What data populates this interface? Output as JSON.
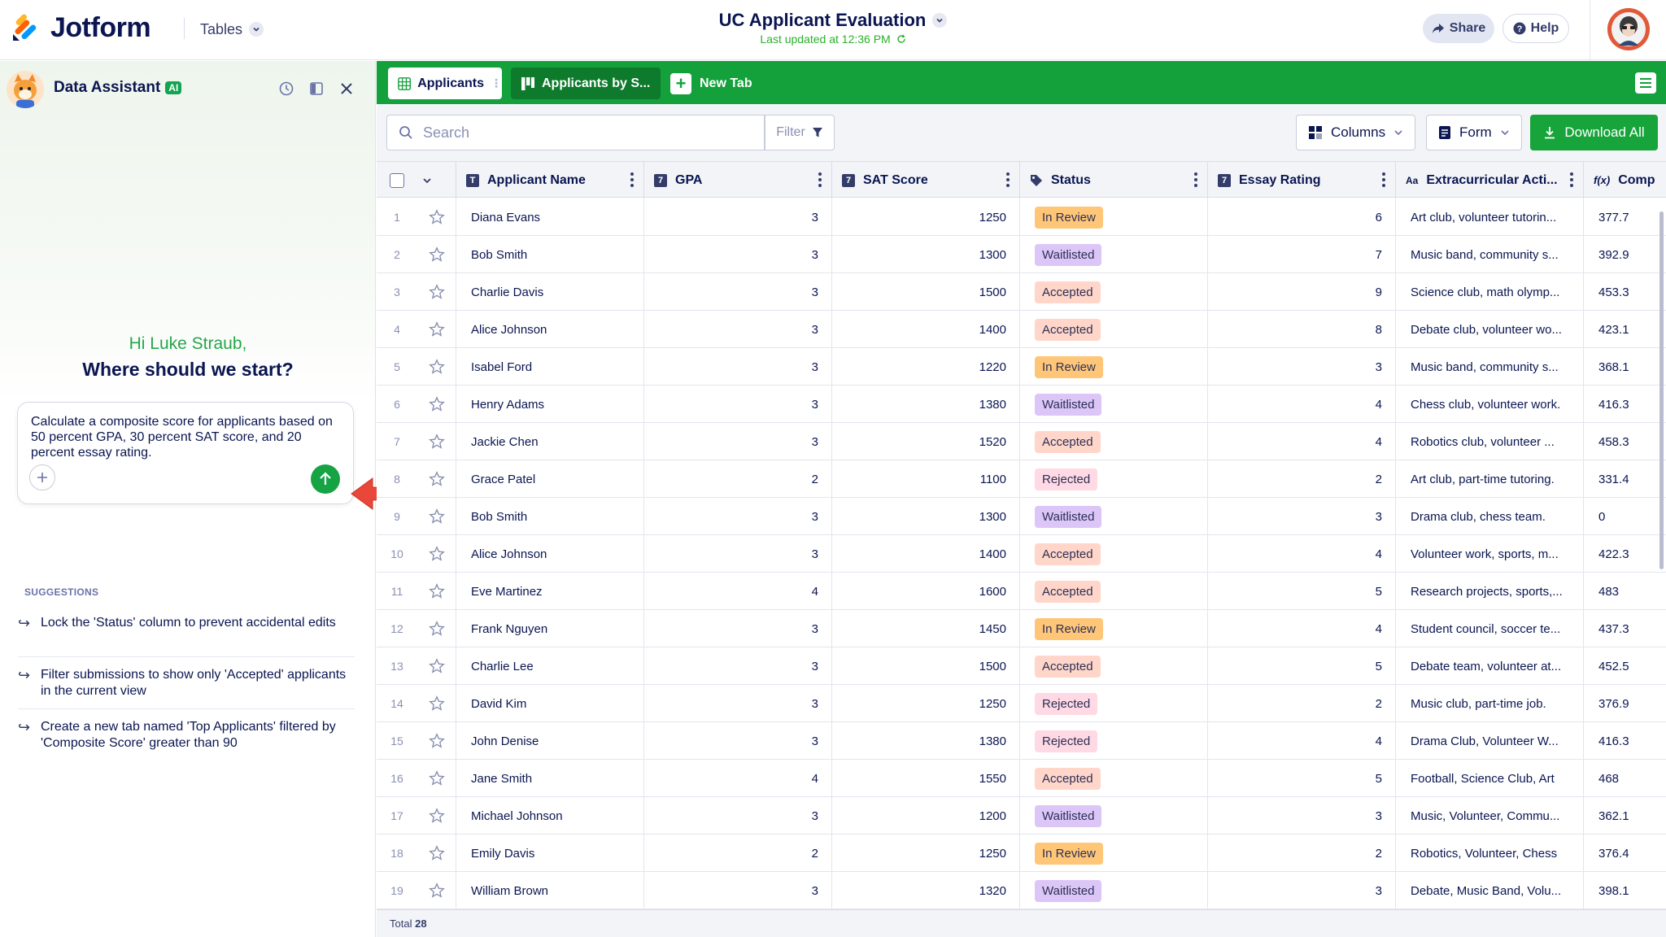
{
  "header": {
    "brand": "Jotform",
    "tables_menu": "Tables",
    "title": "UC Applicant Evaluation",
    "updated": "Last updated at 12:36 PM",
    "share": "Share",
    "help": "Help"
  },
  "assistant": {
    "title": "Data Assistant",
    "badge": "AI",
    "greeting_line1": "Hi Luke Straub,",
    "greeting_line2": "Where should we start?",
    "prompt": "Calculate a composite score for applicants based on 50 percent GPA, 30 percent SAT score, and 20 percent essay rating.",
    "suggestions_label": "SUGGESTIONS",
    "suggestions": [
      "Lock the 'Status' column to prevent accidental edits",
      "Filter submissions to show only 'Accepted' applicants in the current view",
      "Create a new tab named 'Top Applicants' filtered by 'Composite Score' greater than 90"
    ]
  },
  "tabs": {
    "applicants": "Applicants",
    "applicants_by": "Applicants by S...",
    "new_tab": "New Tab"
  },
  "toolbar": {
    "search_placeholder": "Search",
    "filter": "Filter",
    "columns": "Columns",
    "form": "Form",
    "download": "Download All"
  },
  "table": {
    "columns": {
      "name": "Applicant Name",
      "gpa": "GPA",
      "sat": "SAT Score",
      "status": "Status",
      "essay": "Essay Rating",
      "extra": "Extracurricular Acti...",
      "comp": "Comp"
    },
    "type_icons": {
      "text": "T",
      "number": "7",
      "long_text": "Aa",
      "formula": "f(x)"
    },
    "rows": [
      {
        "n": "1",
        "name": "Diana Evans",
        "gpa": "3",
        "sat": "1250",
        "status": "In Review",
        "essay": "6",
        "extra": "Art club, volunteer tutorin...",
        "comp": "377.7"
      },
      {
        "n": "2",
        "name": "Bob Smith",
        "gpa": "3",
        "sat": "1300",
        "status": "Waitlisted",
        "essay": "7",
        "extra": "Music band, community s...",
        "comp": "392.9"
      },
      {
        "n": "3",
        "name": "Charlie Davis",
        "gpa": "3",
        "sat": "1500",
        "status": "Accepted",
        "essay": "9",
        "extra": "Science club, math olymp...",
        "comp": "453.3"
      },
      {
        "n": "4",
        "name": "Alice Johnson",
        "gpa": "3",
        "sat": "1400",
        "status": "Accepted",
        "essay": "8",
        "extra": "Debate club, volunteer wo...",
        "comp": "423.1"
      },
      {
        "n": "5",
        "name": "Isabel Ford",
        "gpa": "3",
        "sat": "1220",
        "status": "In Review",
        "essay": "3",
        "extra": "Music band, community s...",
        "comp": "368.1"
      },
      {
        "n": "6",
        "name": "Henry Adams",
        "gpa": "3",
        "sat": "1380",
        "status": "Waitlisted",
        "essay": "4",
        "extra": "Chess club, volunteer work.",
        "comp": "416.3"
      },
      {
        "n": "7",
        "name": "Jackie Chen",
        "gpa": "3",
        "sat": "1520",
        "status": "Accepted",
        "essay": "4",
        "extra": "Robotics club, volunteer ...",
        "comp": "458.3"
      },
      {
        "n": "8",
        "name": "Grace Patel",
        "gpa": "2",
        "sat": "1100",
        "status": "Rejected",
        "essay": "2",
        "extra": "Art club, part-time tutoring.",
        "comp": "331.4"
      },
      {
        "n": "9",
        "name": "Bob Smith",
        "gpa": "3",
        "sat": "1300",
        "status": "Waitlisted",
        "essay": "3",
        "extra": "Drama club, chess team.",
        "comp": "0"
      },
      {
        "n": "10",
        "name": "Alice Johnson",
        "gpa": "3",
        "sat": "1400",
        "status": "Accepted",
        "essay": "4",
        "extra": "Volunteer work, sports, m...",
        "comp": "422.3"
      },
      {
        "n": "11",
        "name": "Eve Martinez",
        "gpa": "4",
        "sat": "1600",
        "status": "Accepted",
        "essay": "5",
        "extra": "Research projects, sports,...",
        "comp": "483"
      },
      {
        "n": "12",
        "name": "Frank Nguyen",
        "gpa": "3",
        "sat": "1450",
        "status": "In Review",
        "essay": "4",
        "extra": "Student council, soccer te...",
        "comp": "437.3"
      },
      {
        "n": "13",
        "name": "Charlie Lee",
        "gpa": "3",
        "sat": "1500",
        "status": "Accepted",
        "essay": "5",
        "extra": "Debate team, volunteer at...",
        "comp": "452.5"
      },
      {
        "n": "14",
        "name": "David Kim",
        "gpa": "3",
        "sat": "1250",
        "status": "Rejected",
        "essay": "2",
        "extra": "Music club, part-time job.",
        "comp": "376.9"
      },
      {
        "n": "15",
        "name": "John Denise",
        "gpa": "3",
        "sat": "1380",
        "status": "Rejected",
        "essay": "4",
        "extra": "Drama Club, Volunteer W...",
        "comp": "416.3"
      },
      {
        "n": "16",
        "name": "Jane Smith",
        "gpa": "4",
        "sat": "1550",
        "status": "Accepted",
        "essay": "5",
        "extra": "Football, Science Club, Art",
        "comp": "468"
      },
      {
        "n": "17",
        "name": "Michael Johnson",
        "gpa": "3",
        "sat": "1200",
        "status": "Waitlisted",
        "essay": "3",
        "extra": "Music, Volunteer, Commu...",
        "comp": "362.1"
      },
      {
        "n": "18",
        "name": "Emily Davis",
        "gpa": "2",
        "sat": "1250",
        "status": "In Review",
        "essay": "2",
        "extra": "Robotics, Volunteer, Chess",
        "comp": "376.4"
      },
      {
        "n": "19",
        "name": "William Brown",
        "gpa": "3",
        "sat": "1320",
        "status": "Waitlisted",
        "essay": "3",
        "extra": "Debate, Music Band, Volu...",
        "comp": "398.1"
      }
    ],
    "total_label": "Total",
    "total_count": "28"
  },
  "colors": {
    "brand_green": "#14a13b",
    "navy": "#0a1551",
    "in_review": "#ffc678",
    "waitlisted": "#dbc6f7",
    "accepted": "#ffd6c9",
    "rejected": "#ffd9e3"
  }
}
